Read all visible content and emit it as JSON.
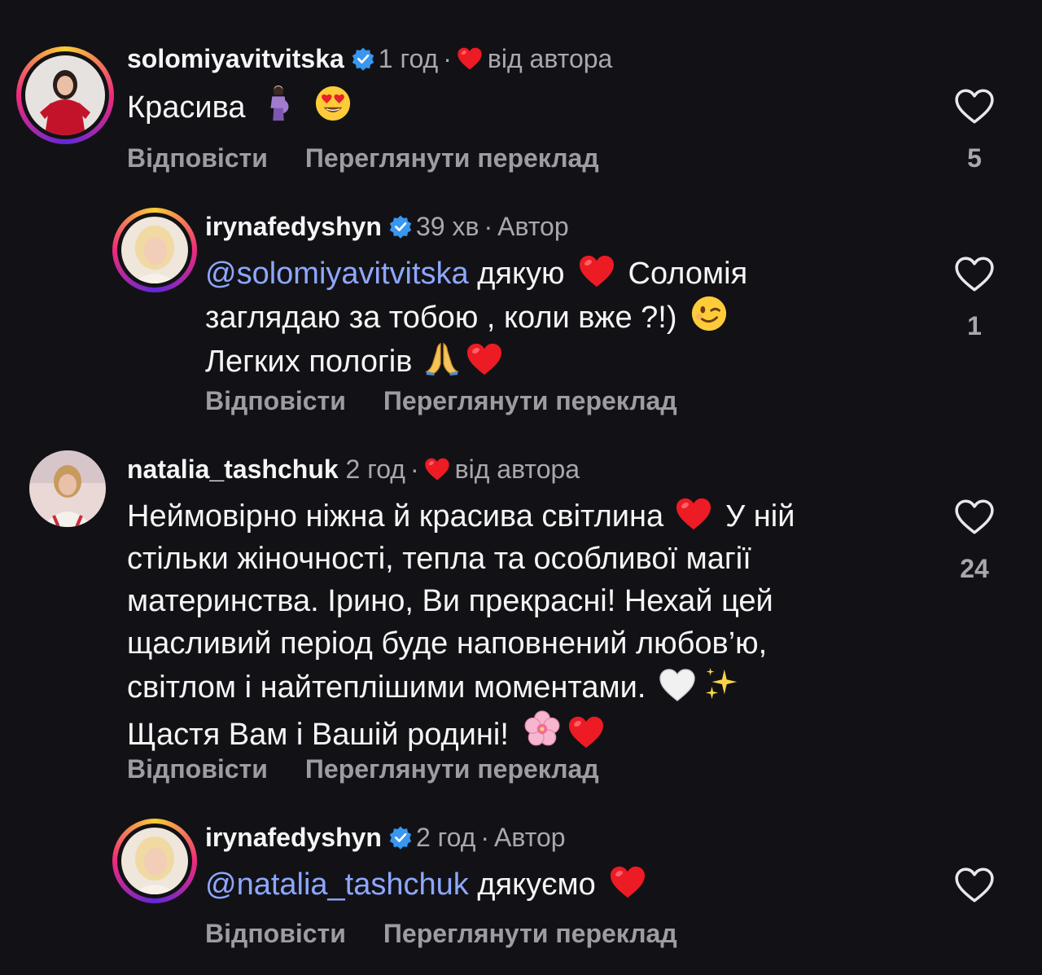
{
  "comments": [
    {
      "username": "solomiyavitvitska",
      "time": "1 год",
      "liked_by_author_label": "від автора",
      "text": "Красива",
      "reply_label": "Відповісти",
      "translate_label": "Переглянути переклад",
      "likes": "5"
    },
    {
      "username": "irynafedyshyn",
      "time": "39 хв",
      "role": "Автор",
      "mention": "@solomiyavitvitska",
      "text_line1": "дякую",
      "text_line1b": "Соломія",
      "text_line2": "заглядаю за тобою , коли вже ?!)",
      "text_line3": "Легких пологів",
      "reply_label": "Відповісти",
      "translate_label": "Переглянути переклад",
      "likes": "1"
    },
    {
      "username": "natalia_tashchuk",
      "time": "2 год",
      "liked_by_author_label": "від автора",
      "lines": [
        "Неймовірно ніжна й красива світлина",
        "стільки жіночності, тепла та особливої магії",
        "материнства. Ірино, Ви прекрасні! Нехай цей",
        "щасливий період буде наповнений любов’ю,",
        "світлом і найтеплішими моментами.",
        "Щастя Вам і Вашій родині!"
      ],
      "line1_tail": "У ній",
      "reply_label": "Відповісти",
      "translate_label": "Переглянути переклад",
      "likes": "24"
    },
    {
      "username": "irynafedyshyn",
      "time": "2 год",
      "role": "Автор",
      "mention": "@natalia_tashchuk",
      "text": "дякуємо",
      "reply_label": "Відповісти",
      "translate_label": "Переглянути переклад"
    }
  ],
  "colors": {
    "background": "#121216",
    "mention": "#8ea7ff",
    "heart": "#ed1b24",
    "verified": "#3897f0"
  }
}
